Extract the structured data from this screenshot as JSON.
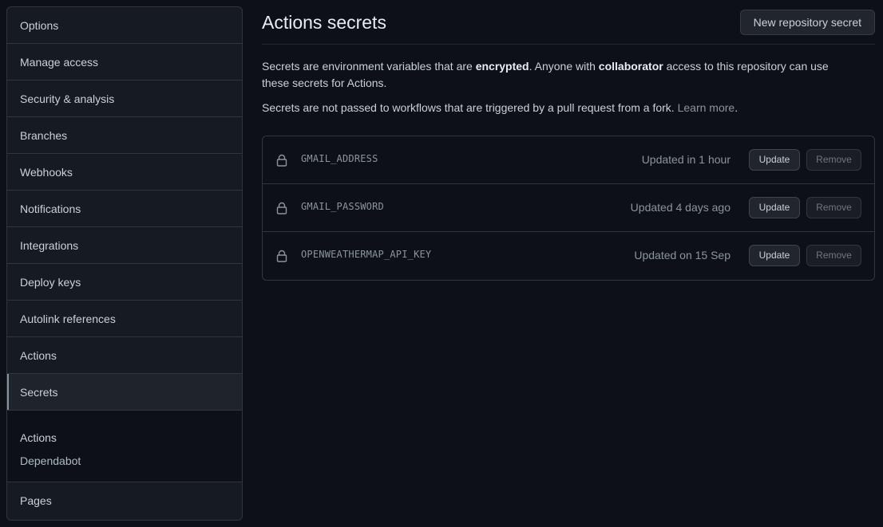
{
  "sidebar": {
    "items": [
      {
        "label": "Options"
      },
      {
        "label": "Manage access"
      },
      {
        "label": "Security & analysis"
      },
      {
        "label": "Branches"
      },
      {
        "label": "Webhooks"
      },
      {
        "label": "Notifications"
      },
      {
        "label": "Integrations"
      },
      {
        "label": "Deploy keys"
      },
      {
        "label": "Autolink references"
      },
      {
        "label": "Actions"
      },
      {
        "label": "Secrets",
        "selected": true
      }
    ],
    "sub_items": [
      {
        "label": "Actions"
      },
      {
        "label": "Dependabot"
      }
    ],
    "bottom_item": {
      "label": "Pages"
    }
  },
  "main": {
    "title": "Actions secrets",
    "new_secret_label": "New repository secret",
    "desc1_a": "Secrets are environment variables that are ",
    "desc1_b": "encrypted",
    "desc1_c": ". Anyone with ",
    "desc1_d": "collaborator",
    "desc1_e": " access to this repository can use these secrets for Actions.",
    "desc2_a": "Secrets are not passed to workflows that are triggered by a pull request from a fork. ",
    "desc2_link": "Learn more",
    "desc2_end": ".",
    "secrets": [
      {
        "name": "GMAIL_ADDRESS",
        "updated": "Updated in 1 hour",
        "update_label": "Update",
        "remove_label": "Remove"
      },
      {
        "name": "GMAIL_PASSWORD",
        "updated": "Updated 4 days ago",
        "update_label": "Update",
        "remove_label": "Remove"
      },
      {
        "name": "OPENWEATHERMAP_API_KEY",
        "updated": "Updated on 15 Sep",
        "update_label": "Update",
        "remove_label": "Remove"
      }
    ]
  },
  "icons": {
    "lock": "lock-icon"
  },
  "colors": {
    "background": "#0d1117",
    "panel": "#161b22",
    "border": "#30363d",
    "text": "#c9d1d9",
    "muted": "#8b949e"
  }
}
